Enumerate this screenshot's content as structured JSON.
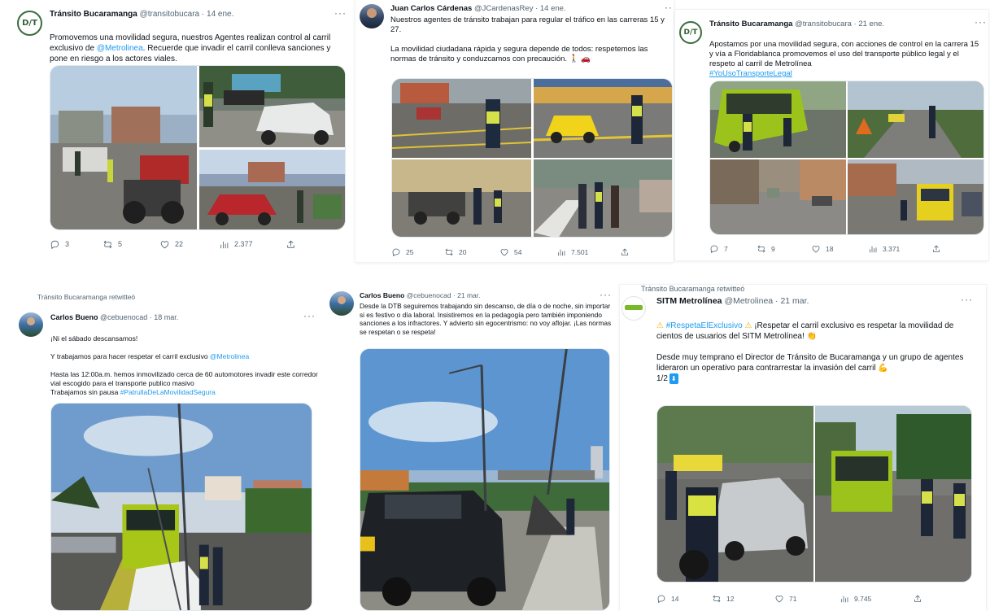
{
  "tweets": [
    {
      "name": "Tránsito Bucaramanga",
      "handle": "@transitobucara",
      "date": "· 14 ene.",
      "text_a": "Promovemos una movilidad segura, nuestros Agentes realizan control al carril exclusivo de ",
      "mention": "@Metrolinea",
      "text_b": ". Recuerde que invadir el carril conlleva sanciones y pone en riesgo a los actores viales.",
      "replies": "3",
      "retweets": "5",
      "likes": "22",
      "views": "2.377"
    },
    {
      "name": "Juan Carlos Cárdenas",
      "handle": "@JCardenasRey · 14 ene.",
      "text": "Nuestros agentes de tránsito trabajan para regular el tráfico en las carreras 15 y 27.\n\nLa movilidad ciudadana rápida y segura depende de todos: respetemos las normas de tránsito y conduzcamos con precaución. 🚶 🚗",
      "replies": "25",
      "retweets": "20",
      "likes": "54",
      "views": "7.501"
    },
    {
      "name": "Tránsito Bucaramanga",
      "handle": "@transitobucara · 21 ene.",
      "text": "Apostamos por una movilidad segura, con acciones de control en la carrera 15 y vía a Floridablanca promovemos el uso del transporte público legal y el respeto al carril de Metrolínea",
      "hashtag": "#YoUsoTransporteLegal",
      "replies": "7",
      "retweets": "9",
      "likes": "18",
      "views": "3.371"
    },
    {
      "retweeted": "Tránsito Bucaramanga retwitteó",
      "name": "Carlos Bueno",
      "handle": "@cebuenocad · 18 mar.",
      "line1": "¡Ni el sábado descansamos!",
      "line2a": "Y trabajamos para hacer respetar el carril exclusivo ",
      "mention": "@Metrolinea",
      "line3": "Hasta las 12:00a.m. hemos inmovilizado cerca de 60 automotores invadir este corredor vial escogido para el transporte publico masivo\nTrabajamos sin pausa ",
      "hashtag": "#PatrullaDeLaMovilidadSegura"
    },
    {
      "name": "Carlos Bueno",
      "handle": "@cebuenocad · 21 mar.",
      "text": "Desde la DTB seguiremos trabajando sin descanso, de día o de noche, sin importar si es festivo o día laboral. Insistiremos en la pedagogía pero también imponiendo sanciones a los infractores. Y advierto sin egocentrismo: no voy aflojar. ¡Las normas se respetan o se respeta!"
    },
    {
      "retweeted": "Tránsito Bucaramanga retwitteó",
      "name": "SITM Metrolínea",
      "handle": "@Metrolinea · 21 mar.",
      "hashtag": "#RespetaElExclusivo",
      "line1b": " ¡Respetar el carril exclusivo es respetar la movilidad de cientos de usuarios del SITM Metrolínea! 👏",
      "line2": "Desde muy temprano el Director de Tránsito de Bucaramanga y un grupo de agentes lideraron un operativo para contrarrestar la invasión del carril 💪",
      "counter": "1/2",
      "replies": "14",
      "retweets": "12",
      "likes": "71",
      "views": "9.745"
    }
  ],
  "icons": {
    "avatar_dtb": "D/T",
    "warning": "⚠",
    "down_arrow": "⬇"
  },
  "colors": {
    "link": "#1d9bf0",
    "text": "#0f1419",
    "muted": "#536471",
    "bus_green": "#9cc31b",
    "taxi_yellow": "#f2d31b"
  }
}
